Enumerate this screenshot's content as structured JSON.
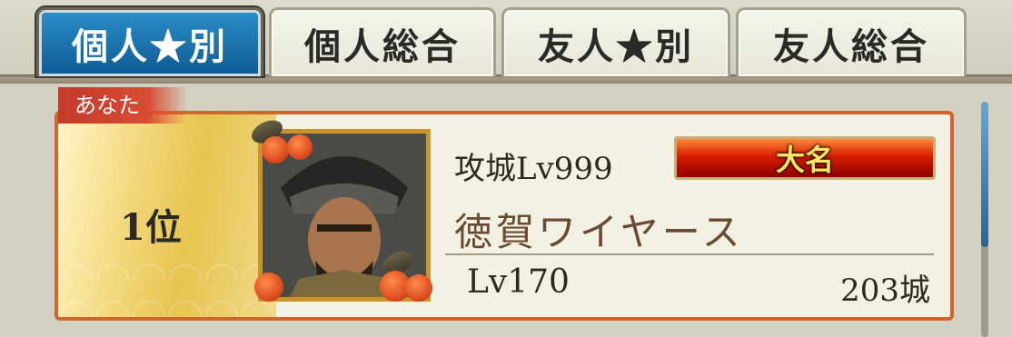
{
  "tabs": [
    {
      "label": "個人★別",
      "active": true
    },
    {
      "label": "個人総合",
      "active": false
    },
    {
      "label": "友人★別",
      "active": false
    },
    {
      "label": "友人総合",
      "active": false
    }
  ],
  "entry": {
    "badge": "あなた",
    "rank": "1位",
    "siege_level": "攻城Lv999",
    "title": "大名",
    "name": "徳賀ワイヤース",
    "level": "Lv170",
    "castles": "203城"
  },
  "colors": {
    "active_tab": "#1a73b0",
    "card_border": "#d4652a",
    "title_badge": "#d71e00"
  }
}
